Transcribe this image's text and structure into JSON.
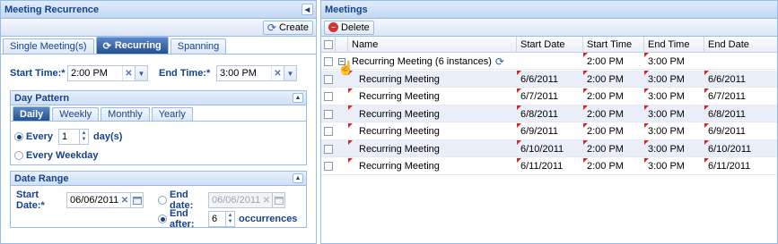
{
  "left_panel": {
    "title": "Meeting Recurrence",
    "toolbar": {
      "create_label": "Create"
    },
    "tabs": [
      {
        "label": "Single Meeting(s)"
      },
      {
        "label": "Recurring"
      },
      {
        "label": "Spanning"
      }
    ],
    "start_time": {
      "label": "Start Time:*",
      "value": "2:00 PM"
    },
    "end_time": {
      "label": "End Time:*",
      "value": "3:00 PM"
    },
    "day_pattern": {
      "title": "Day Pattern",
      "tabs": [
        {
          "label": "Daily"
        },
        {
          "label": "Weekly"
        },
        {
          "label": "Monthly"
        },
        {
          "label": "Yearly"
        }
      ],
      "every_label": "Every",
      "every_value": "1",
      "days_label": "day(s)",
      "every_weekday_label": "Every Weekday"
    },
    "date_range": {
      "title": "Date Range",
      "start_date_label": "Start Date:*",
      "start_date_value": "06/06/2011",
      "end_date_label": "End date:",
      "end_date_value": "06/06/2011",
      "end_after_label": "End after:",
      "end_after_value": "6",
      "occurrences_label": "occurrences"
    }
  },
  "right_panel": {
    "title": "Meetings",
    "toolbar": {
      "delete_label": "Delete"
    },
    "columns": [
      "Name",
      "Start Date",
      "Start Time",
      "End Time",
      "End Date"
    ],
    "parent_row": {
      "name": "Recurring Meeting (6 instances)",
      "start_time": "2:00 PM",
      "end_time": "3:00 PM"
    },
    "rows": [
      {
        "name": "Recurring Meeting",
        "start_date": "6/6/2011",
        "start_time": "2:00 PM",
        "end_time": "3:00 PM",
        "end_date": "6/6/2011"
      },
      {
        "name": "Recurring Meeting",
        "start_date": "6/7/2011",
        "start_time": "2:00 PM",
        "end_time": "3:00 PM",
        "end_date": "6/7/2011"
      },
      {
        "name": "Recurring Meeting",
        "start_date": "6/8/2011",
        "start_time": "2:00 PM",
        "end_time": "3:00 PM",
        "end_date": "6/8/2011"
      },
      {
        "name": "Recurring Meeting",
        "start_date": "6/9/2011",
        "start_time": "2:00 PM",
        "end_time": "3:00 PM",
        "end_date": "6/9/2011"
      },
      {
        "name": "Recurring Meeting",
        "start_date": "6/10/2011",
        "start_time": "2:00 PM",
        "end_time": "3:00 PM",
        "end_date": "6/10/2011"
      },
      {
        "name": "Recurring Meeting",
        "start_date": "6/11/2011",
        "start_time": "2:00 PM",
        "end_time": "3:00 PM",
        "end_date": "6/11/2011"
      }
    ]
  }
}
